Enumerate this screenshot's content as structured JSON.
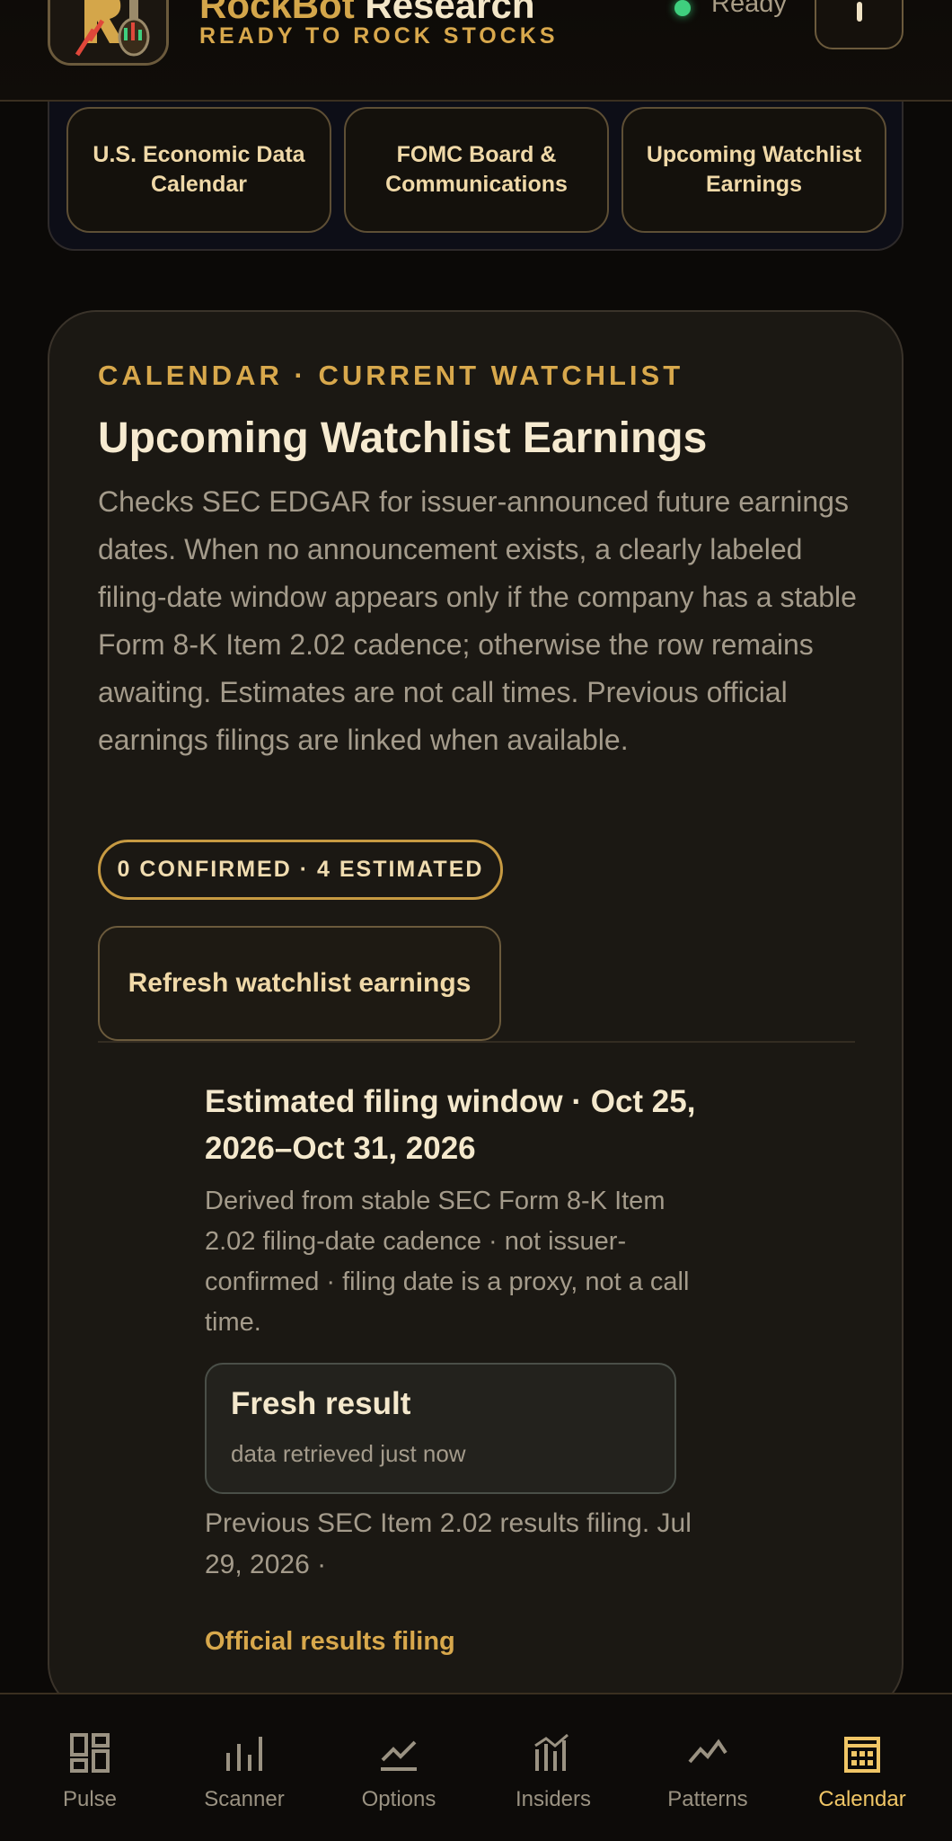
{
  "header": {
    "title_part1": "RockBot",
    "title_part2": " Research",
    "subtitle": "READY TO ROCK STOCKS",
    "status": "Ready"
  },
  "top_tabs": [
    {
      "label": "U.S. Economic Data Calendar"
    },
    {
      "label": "FOMC Board & Communications"
    },
    {
      "label": "Upcoming Watchlist Earnings"
    }
  ],
  "card": {
    "eyebrow": "CALENDAR · CURRENT WATCHLIST",
    "title": "Upcoming Watchlist Earnings",
    "description": "Checks SEC EDGAR for issuer-announced future earnings dates. When no announcement exists, a clearly labeled filing-date window appears only if the company has a stable Form 8-K Item 2.02 cadence; otherwise the row remains awaiting. Estimates are not call times. Previous official earnings filings are linked when available.",
    "counts_pill": "0 CONFIRMED · 4 ESTIMATED",
    "refresh_label": "Refresh watchlist earnings",
    "entry": {
      "title": "Estimated filing window · Oct 25, 2026–Oct 31, 2026",
      "description": "Derived from stable SEC Form 8-K Item 2.02 filing-date cadence · not issuer-confirmed · filing date is a proxy, not a call time.",
      "fresh_title": "Fresh result",
      "fresh_sub": "data retrieved just now",
      "previous": "Previous SEC Item 2.02 results filing. Jul 29, 2026 ·",
      "link_label": "Official results filing"
    }
  },
  "bottom_nav": [
    {
      "label": "Pulse",
      "icon": "dashboard-icon"
    },
    {
      "label": "Scanner",
      "icon": "bars-icon"
    },
    {
      "label": "Options",
      "icon": "trend-line-icon"
    },
    {
      "label": "Insiders",
      "icon": "insider-chart-icon"
    },
    {
      "label": "Patterns",
      "icon": "pattern-icon"
    },
    {
      "label": "Calendar",
      "icon": "calendar-icon",
      "active": true
    }
  ],
  "colors": {
    "accent": "#d8a84c",
    "status_green": "#3fcf7e",
    "background": "#0b0907",
    "card": "#1b1813"
  }
}
